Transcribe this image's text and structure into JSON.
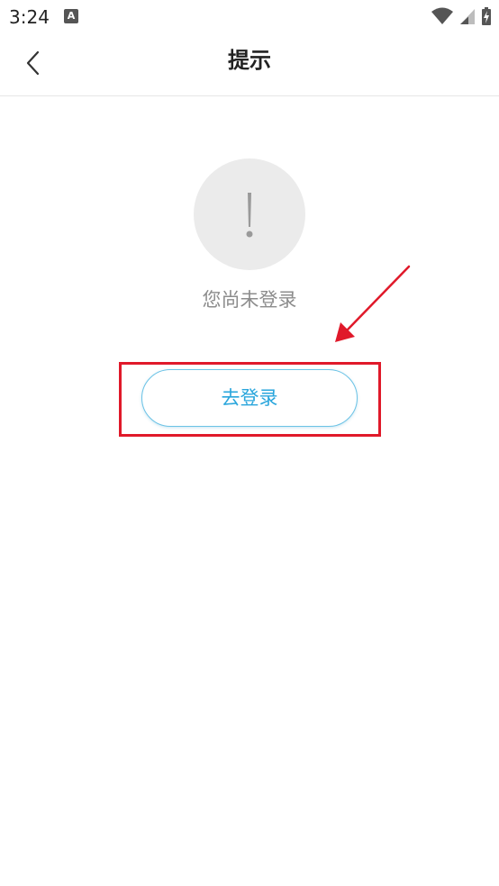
{
  "status_bar": {
    "time": "3:24",
    "notification_icon": "A"
  },
  "header": {
    "title": "提示",
    "back_icon": "chevron-left-icon"
  },
  "main": {
    "alert_icon": "exclamation-icon",
    "message": "您尚未登录",
    "login_button_label": "去登录"
  },
  "colors": {
    "accent": "#2aa6dc",
    "annotation": "#e0192a"
  }
}
